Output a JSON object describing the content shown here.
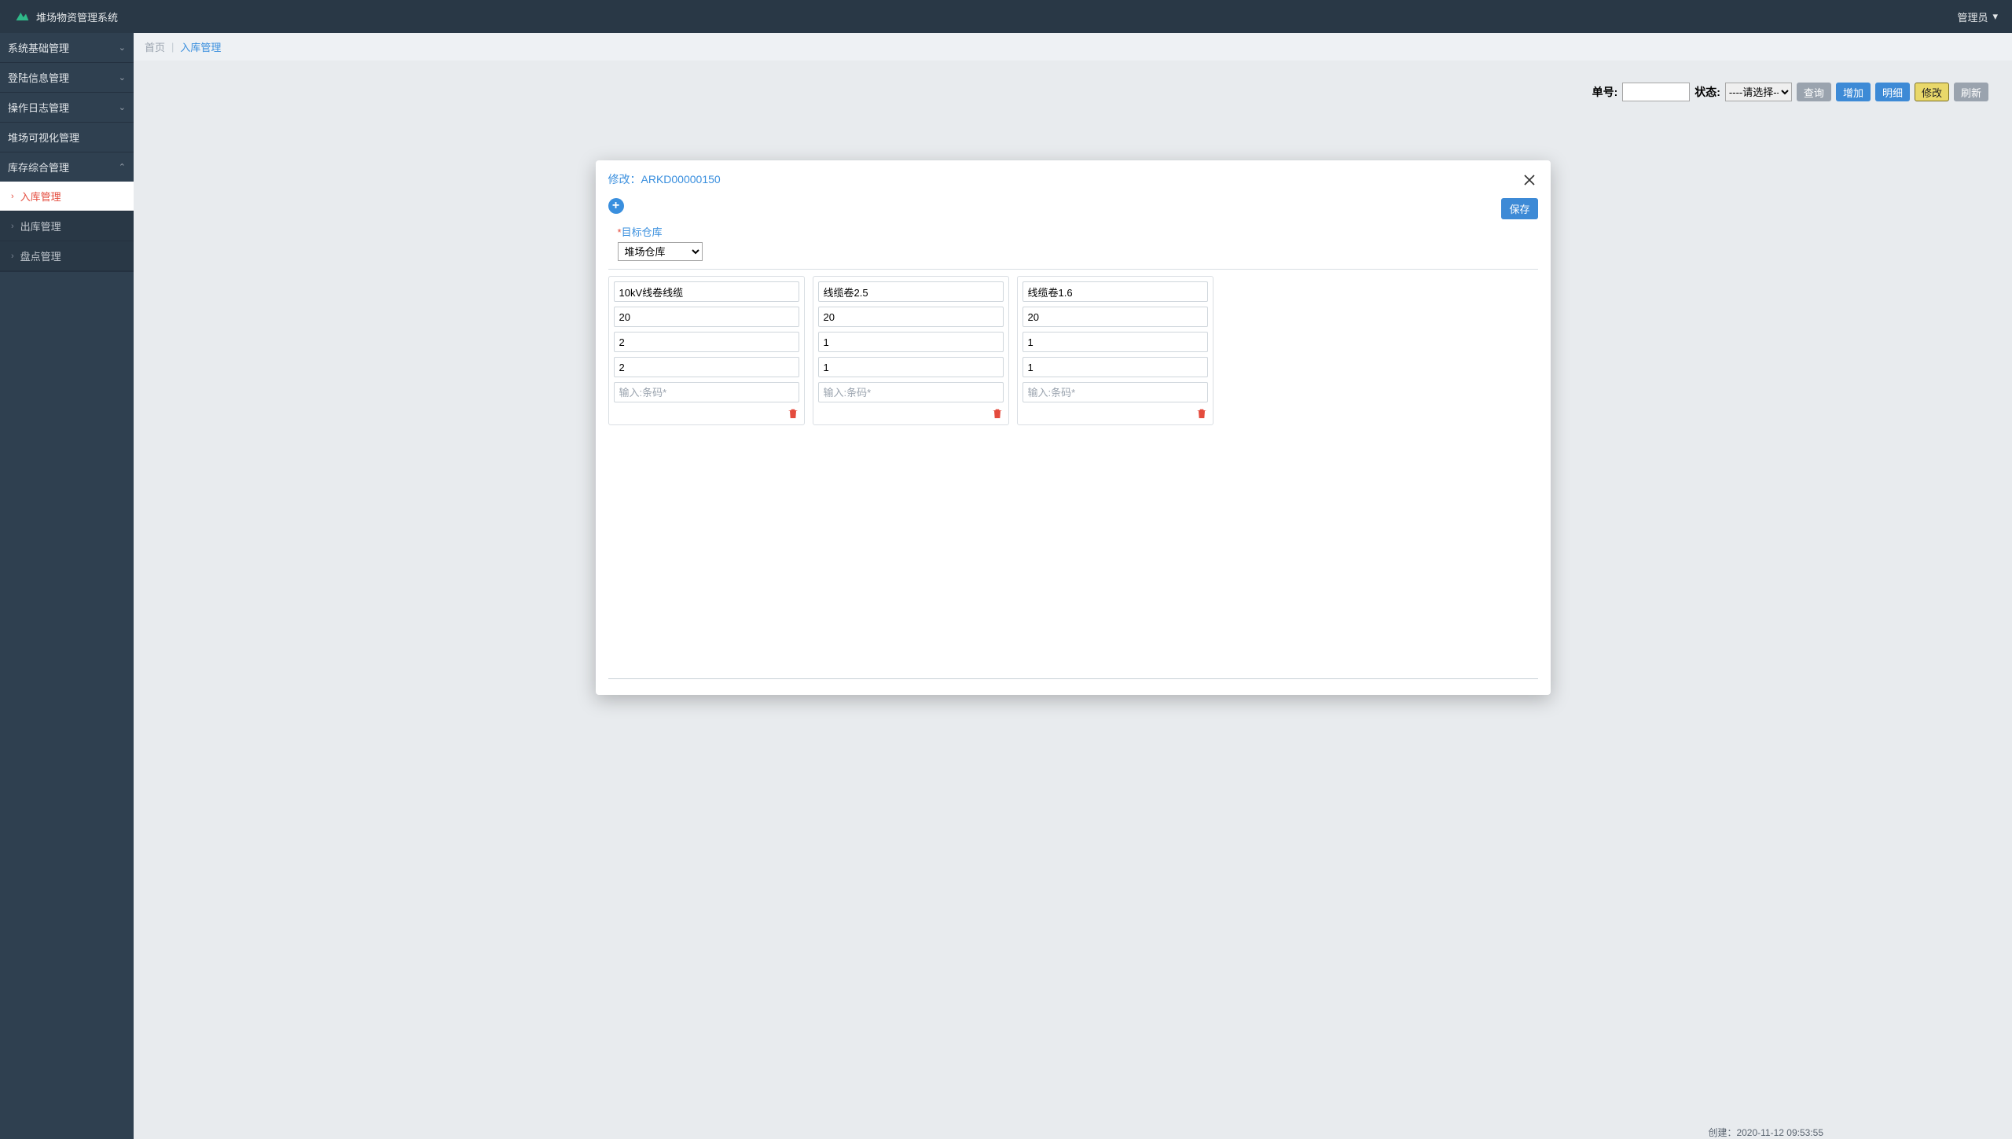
{
  "topbar": {
    "title": "堆场物资管理系统",
    "user": "管理员"
  },
  "sidebar": {
    "sections": [
      {
        "label": "系统基础管理",
        "arrow": "down"
      },
      {
        "label": "登陆信息管理",
        "arrow": "down"
      },
      {
        "label": "操作日志管理",
        "arrow": "down"
      },
      {
        "label": "堆场可视化管理",
        "arrow": "none"
      },
      {
        "label": "库存综合管理",
        "arrow": "up"
      }
    ],
    "sub": [
      {
        "label": "入库管理",
        "active": true
      },
      {
        "label": "出库管理",
        "active": false
      },
      {
        "label": "盘点管理",
        "active": false
      }
    ]
  },
  "breadcrumb": {
    "home": "首页",
    "current": "入库管理"
  },
  "filter": {
    "order_label": "单号:",
    "status_label": "状态:",
    "status_selected": "----请选择----",
    "btns": {
      "query": "查询",
      "add": "增加",
      "detail": "明细",
      "edit": "修改",
      "refresh": "刷新"
    }
  },
  "modal": {
    "title_prefix": "修改：",
    "order_no": "ARKD00000150",
    "save": "保存",
    "target_label": "目标仓库",
    "target_value": "堆场仓库",
    "barcode_placeholder": "输入:条码*",
    "cards": [
      {
        "name": "10kV线卷线缆",
        "v1": "20",
        "v2": "2",
        "v3": "2"
      },
      {
        "name": "线缆卷2.5",
        "v1": "20",
        "v2": "1",
        "v3": "1"
      },
      {
        "name": "线缆卷1.6",
        "v1": "20",
        "v2": "1",
        "v3": "1"
      }
    ]
  },
  "peek": {
    "created_label": "创建：",
    "created_value": "2020-11-12 09:53:55"
  },
  "colors": {
    "accent": "#3a8fde",
    "danger": "#e44b3d"
  }
}
